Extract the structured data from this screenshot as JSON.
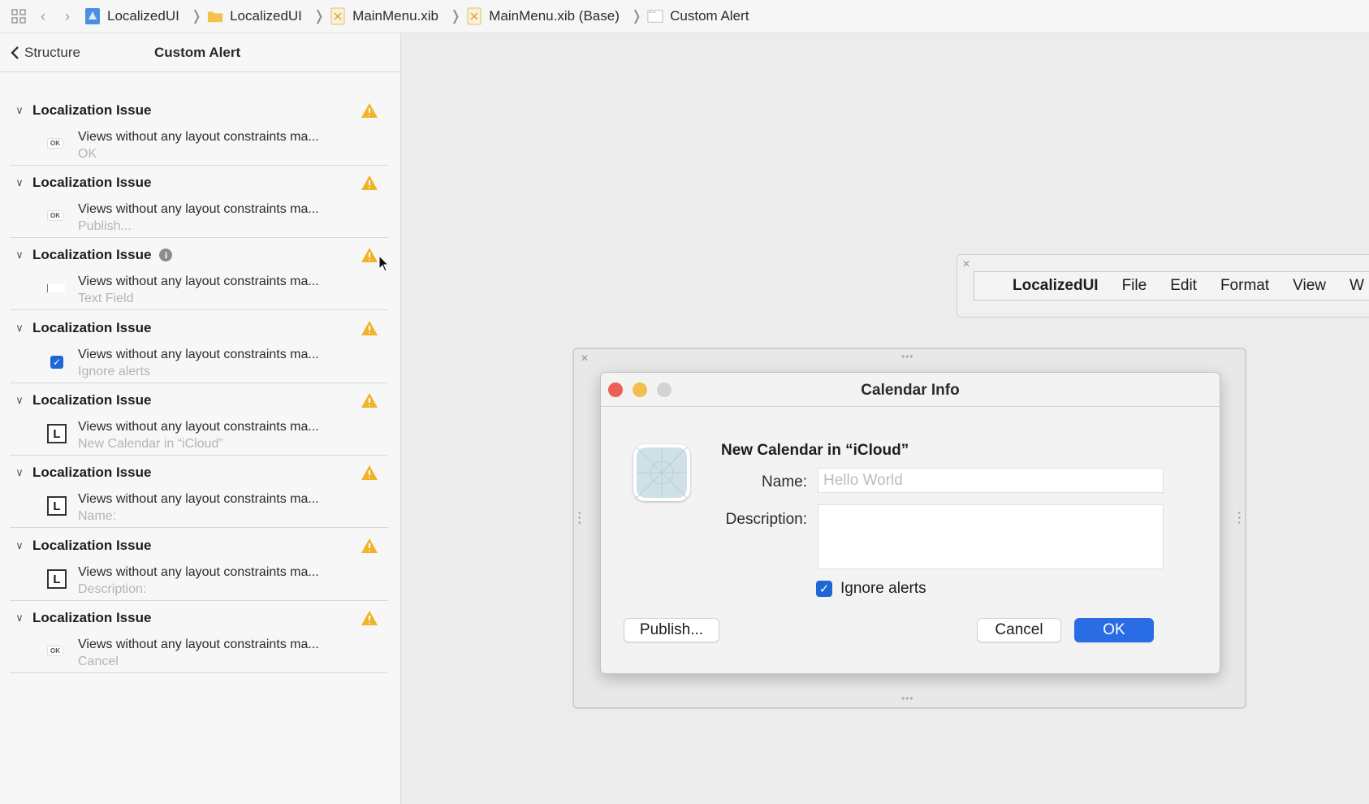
{
  "breadcrumb": {
    "items": [
      "LocalizedUI",
      "LocalizedUI",
      "MainMenu.xib",
      "MainMenu.xib (Base)",
      "Custom Alert"
    ]
  },
  "sidebar": {
    "back_label": "Structure",
    "title": "Custom Alert",
    "issues": [
      {
        "title": "Localization Issue",
        "desc": "Views without any layout constraints ma...",
        "sub": "OK",
        "thumb": "ok-button"
      },
      {
        "title": "Localization Issue",
        "desc": "Views without any layout constraints ma...",
        "sub": "Publish...",
        "thumb": "ok-button"
      },
      {
        "title": "Localization Issue",
        "desc": "Views without any layout constraints ma...",
        "sub": "Text Field",
        "thumb": "text-field"
      },
      {
        "title": "Localization Issue",
        "desc": "Views without any layout constraints ma...",
        "sub": "Ignore alerts",
        "thumb": "checkbox"
      },
      {
        "title": "Localization Issue",
        "desc": "Views without any layout constraints ma...",
        "sub": "New Calendar in “iCloud”",
        "thumb": "label"
      },
      {
        "title": "Localization Issue",
        "desc": "Views without any layout constraints ma...",
        "sub": "Name:",
        "thumb": "label"
      },
      {
        "title": "Localization Issue",
        "desc": "Views without any layout constraints ma...",
        "sub": "Description:",
        "thumb": "label"
      },
      {
        "title": "Localization Issue",
        "desc": "Views without any layout constraints ma...",
        "sub": "Cancel",
        "thumb": "ok-button"
      }
    ]
  },
  "menubar": {
    "app": "LocalizedUI",
    "items": [
      "File",
      "Edit",
      "Format",
      "View",
      "W"
    ]
  },
  "dialog": {
    "title": "Calendar Info",
    "headline": "New Calendar in “iCloud”",
    "name_label": "Name:",
    "name_placeholder": "Hello World",
    "description_label": "Description:",
    "checkbox_label": "Ignore alerts",
    "checkbox_checked": true,
    "publish_label": "Publish...",
    "cancel_label": "Cancel",
    "ok_label": "OK"
  },
  "colors": {
    "accent": "#2a6ce3",
    "warning": "#f0b429",
    "close": "#ed5f56",
    "minimize": "#f4bd4f"
  }
}
